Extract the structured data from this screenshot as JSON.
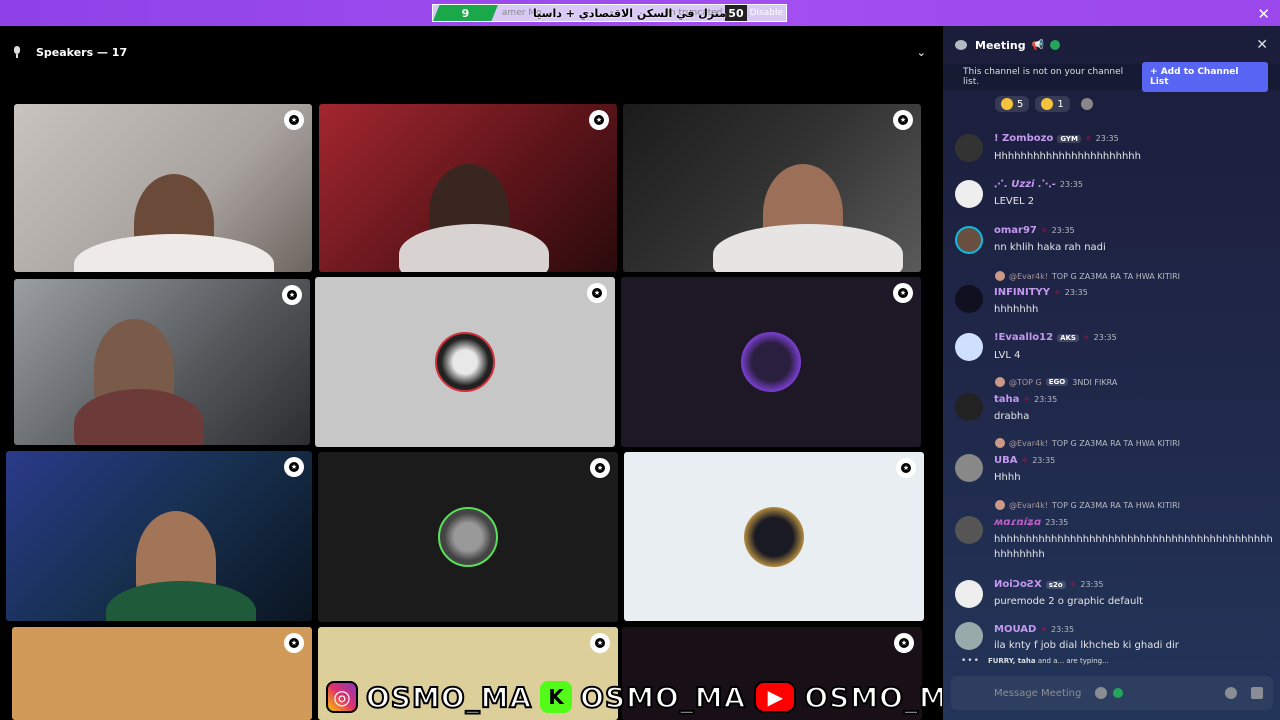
{
  "topbar": {
    "ticker_left": "9",
    "ticker_text": "amer Mo",
    "ticker_arabic": "منزل في السكن الاقتصادي + داسيا",
    "ticker_mid": "en truncated.",
    "ticker_count": "50",
    "ticker_tail": "Disable",
    "close_label": "✕"
  },
  "stage": {
    "title": "Speakers — 17",
    "chevron": "⌄"
  },
  "watermark": {
    "handle1": "OSMO_MA",
    "handle2": "OSMO_MA",
    "handle3": "OSMO_MA",
    "kick_glyph": "K",
    "ig_glyph": "◎",
    "yt_glyph": "▶"
  },
  "panel": {
    "channel": "Meeting",
    "channel_emoji": "📢",
    "close": "✕",
    "notice": "This channel is not on your channel list.",
    "add_button": "+ Add to Channel List",
    "reactions": [
      {
        "count": "5"
      },
      {
        "count": "1"
      }
    ],
    "messages": [
      {
        "name": "! Zombozo",
        "role": "GYM",
        "time": "23:35",
        "text": "Hhhhhhhhhhhhhhhhhhhhhhh",
        "reply": "",
        "reply_text": ""
      },
      {
        "name": "⋰. Uzzi .⋱-",
        "role": "",
        "time": "23:35",
        "text": "LEVEL 2",
        "reply": "",
        "reply_text": ""
      },
      {
        "name": "omar97",
        "role": "",
        "time": "23:35",
        "text": "nn khlih haka rah nadi",
        "reply": "",
        "reply_text": ""
      },
      {
        "name": "INFINITYY",
        "role": "",
        "time": "23:35",
        "text": "hhhhhhh",
        "reply": "@Evar4k!",
        "reply_text": "TOP G ZA3MA RA TA HWA KITIRI"
      },
      {
        "name": "!Evaallo12",
        "role": "AKS",
        "time": "23:35",
        "text": "LVL 4",
        "reply": "",
        "reply_text": ""
      },
      {
        "name": "taha",
        "role": "",
        "time": "23:35",
        "text": "drabha",
        "reply": "@TOP G",
        "reply_text": "3NDI FIKRA"
      },
      {
        "name": "UBA",
        "role": "",
        "time": "23:35",
        "text": "Hhhh",
        "reply": "@Evar4k!",
        "reply_text": "TOP G ZA3MA RA TA HWA KITIRI"
      },
      {
        "name": "ʍɑɾռíʑɑ",
        "role": "",
        "time": "23:35",
        "text": "hhhhhhhhhhhhhhhhhhhhhhhhhhhhhhhhhhhhhhhhhhhh hhhhhhhh",
        "reply": "@Evar4k!",
        "reply_text": "TOP G ZA3MA RA TA HWA KITIRI"
      },
      {
        "name": "ИoiƆoƧX",
        "role": "s2o",
        "time": "23:35",
        "text": "puremode 2 o graphic default",
        "reply": "",
        "reply_text": ""
      },
      {
        "name": "MOUAD",
        "role": "",
        "time": "23:35",
        "text": "ila knty f job dial lkhcheb ki ghadi dir",
        "reply": "",
        "reply_text": ""
      }
    ],
    "reply_chip": "EGO",
    "typing_names": "FURRY, taha",
    "typing_suffix": "and a... are typing...",
    "composer_placeholder": "Message Meeting"
  }
}
